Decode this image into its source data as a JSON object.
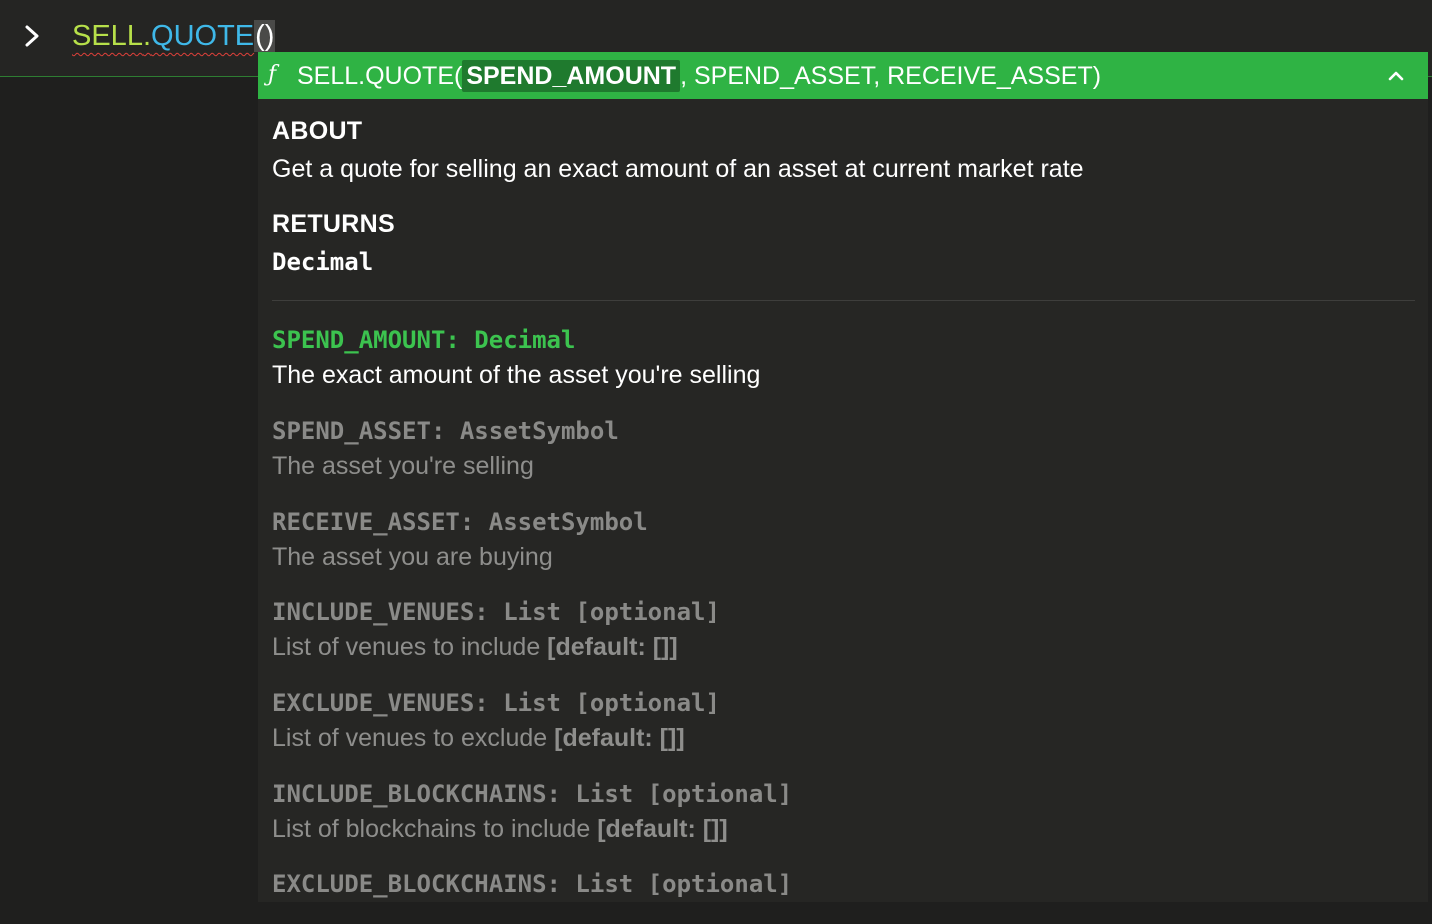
{
  "editor": {
    "formula_namespace": "SELL",
    "formula_dot": ".",
    "formula_function": "QUOTE",
    "formula_parens": "()"
  },
  "signature": {
    "prefix": "SELL.QUOTE(",
    "active_param": "SPEND_AMOUNT",
    "rest": ", SPEND_ASSET, RECEIVE_ASSET)",
    "fn_icon": "ƒ"
  },
  "about": {
    "heading": "ABOUT",
    "text": "Get a quote for selling an exact amount of an asset at current market rate"
  },
  "returns": {
    "heading": "RETURNS",
    "type": "Decimal"
  },
  "params": [
    {
      "signature": "SPEND_AMOUNT: Decimal",
      "description": "The exact amount of the asset you're selling",
      "default": ""
    },
    {
      "signature": "SPEND_ASSET: AssetSymbol",
      "description": "The asset you're selling",
      "default": ""
    },
    {
      "signature": "RECEIVE_ASSET: AssetSymbol",
      "description": "The asset you are buying",
      "default": ""
    },
    {
      "signature": "INCLUDE_VENUES: List [optional]",
      "description": "List of venues to include ",
      "default": "[default: []]"
    },
    {
      "signature": "EXCLUDE_VENUES: List [optional]",
      "description": "List of venues to exclude ",
      "default": "[default: []]"
    },
    {
      "signature": "INCLUDE_BLOCKCHAINS: List [optional]",
      "description": "List of blockchains to include ",
      "default": "[default: []]"
    },
    {
      "signature": "EXCLUDE_BLOCKCHAINS: List [optional]",
      "description": "",
      "default": ""
    }
  ],
  "colors": {
    "accent_green": "#2fb344",
    "active_param_green": "#3cc34f",
    "namespace_color": "#b7e04a",
    "function_color": "#3fb8e8",
    "error_squiggle": "#e0403a"
  }
}
